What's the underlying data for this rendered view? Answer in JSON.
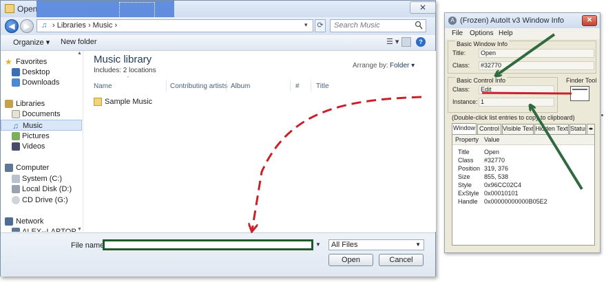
{
  "open_dialog": {
    "title": "Open",
    "close_glyph": "✕",
    "address_text": "› Libraries › Music ›",
    "search_placeholder": "Search Music",
    "toolbar": {
      "organize": "Organize ▾",
      "new_folder": "New folder",
      "views_glyph": "☰ ▾",
      "help_glyph": "?"
    },
    "nav": {
      "favorites": "Favorites",
      "desktop": "Desktop",
      "downloads": "Downloads",
      "libraries": "Libraries",
      "documents": "Documents",
      "music": "Music",
      "pictures": "Pictures",
      "videos": "Videos",
      "computer": "Computer",
      "system_c": "System (C:)",
      "local_disk_d": "Local Disk (D:)",
      "cd_drive_g": "CD Drive (G:)",
      "network": "Network",
      "alex_laptop": "ALEX--LAPTOP"
    },
    "content": {
      "library_title": "Music library",
      "library_subtitle": "Includes: 2 locations",
      "arrange_label": "Arrange by:",
      "arrange_value": "Folder ▾",
      "columns": {
        "name": "Name",
        "artists": "Contributing artists",
        "album": "Album",
        "num": "#",
        "title": "Title"
      },
      "items": [
        "Sample Music"
      ]
    },
    "file_name_label": "File name:",
    "file_name_value": "",
    "file_type": "All Files",
    "open_button": "Open",
    "cancel_button": "Cancel"
  },
  "autoit": {
    "title": "(Frozen) AutoIt v3 Window Info",
    "menu": [
      "File",
      "Options",
      "Help"
    ],
    "basic_window": {
      "legend": "Basic Window Info",
      "title_label": "Title:",
      "title_value": "Open",
      "class_label": "Class:",
      "class_value": "#32770"
    },
    "basic_control": {
      "legend": "Basic Control Info",
      "class_label": "Class:",
      "class_value": "Edit",
      "instance_label": "Instance:",
      "instance_value": "1"
    },
    "finder_tool": "Finder Tool",
    "hint": "(Double-click list entries to copy to clipboard)",
    "tabs": [
      "Window",
      "Control",
      "Visible Text",
      "Hidden Text",
      "StatusBar"
    ],
    "list_headers": [
      "Property",
      "Value"
    ],
    "properties": [
      {
        "name": "Title",
        "value": "Open"
      },
      {
        "name": "Class",
        "value": "#32770"
      },
      {
        "name": "Position",
        "value": "319, 376"
      },
      {
        "name": "Size",
        "value": "855, 538"
      },
      {
        "name": "Style",
        "value": "0x96CC02C4"
      },
      {
        "name": "ExStyle",
        "value": "0x00010101"
      },
      {
        "name": "Handle",
        "value": "0x00000000000B05E2"
      }
    ]
  },
  "annotation_colors": {
    "green_arrows": "#2f6b3f",
    "red_line": "#c8212a"
  }
}
